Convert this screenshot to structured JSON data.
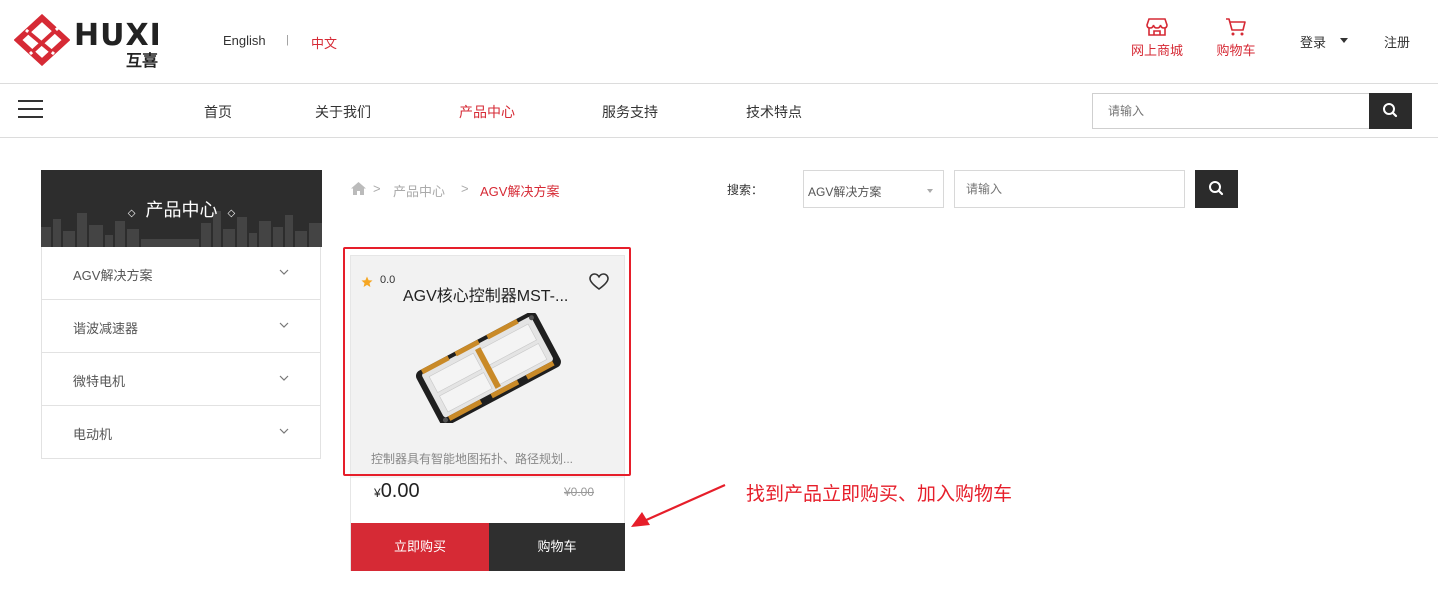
{
  "brand": {
    "name": "HUXI",
    "sub": "互喜"
  },
  "language": {
    "english": "English",
    "separator": "|",
    "chinese": "中文"
  },
  "top_links": {
    "shop": "网上商城",
    "cart": "购物车",
    "login": "登录",
    "register": "注册"
  },
  "nav": {
    "items": [
      "首页",
      "关于我们",
      "产品中心",
      "服务支持",
      "技术特点"
    ],
    "active": "产品中心",
    "search_placeholder": "请输入"
  },
  "sidebar": {
    "title": "产品中心",
    "items": [
      "AGV解决方案",
      "谐波减速器",
      "微特电机",
      "电动机"
    ]
  },
  "breadcrumb": {
    "sep": ">",
    "parent": "产品中心",
    "current": "AGV解决方案"
  },
  "filter": {
    "label": "搜索：",
    "category": "AGV解决方案",
    "placeholder": "请输入"
  },
  "product": {
    "rating": "0.0",
    "title": "AGV核心控制器MST-...",
    "description": "控制器具有智能地图拓扑、路径规划...",
    "currency": "¥",
    "price": "0.00",
    "original_price": "¥0.00",
    "buy_label": "立即购买",
    "cart_label": "购物车"
  },
  "annotation": {
    "text": "找到产品立即购买、加入购物车",
    "color": "#e61e2a"
  },
  "colors": {
    "accent": "#d62a35",
    "dark": "#2b2b2b"
  },
  "icons": [
    "logo-icon",
    "store-icon",
    "cart-icon",
    "hamburger-icon",
    "search-icon",
    "home-icon",
    "chevron-down-icon",
    "star-icon",
    "heart-icon"
  ]
}
